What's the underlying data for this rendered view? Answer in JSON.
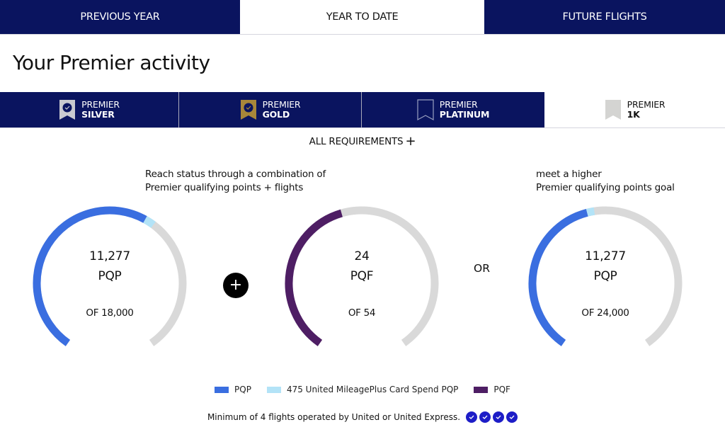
{
  "top_tabs": [
    {
      "label": "PREVIOUS YEAR",
      "active": false
    },
    {
      "label": "YEAR TO DATE",
      "active": true
    },
    {
      "label": "FUTURE FLIGHTS",
      "active": false
    }
  ],
  "page_title": "Your Premier activity",
  "tiers": [
    {
      "line1": "PREMIER",
      "line2": "SILVER",
      "icon": "silver-badge-icon",
      "badge_color": "#c9cad0",
      "selected": false
    },
    {
      "line1": "PREMIER",
      "line2": "GOLD",
      "icon": "gold-badge-icon",
      "badge_color": "#a8873a",
      "selected": false
    },
    {
      "line1": "PREMIER",
      "line2": "PLATINUM",
      "icon": "platinum-badge-outline-icon",
      "badge_color": "#0a145f",
      "selected": false
    },
    {
      "line1": "PREMIER",
      "line2": "1K",
      "icon": "1k-badge-icon",
      "badge_color": "#d4d4d2",
      "selected": true
    }
  ],
  "all_requirements": {
    "label": "ALL REQUIREMENTS",
    "icon": "+"
  },
  "descriptions": {
    "combo_line1": "Reach status through a combination of",
    "combo_line2": "Premier qualifying points + flights",
    "higher_line1": "meet a higher",
    "higher_line2": "Premier qualifying points goal"
  },
  "gauges": [
    {
      "value": "11,277",
      "unit": "PQP",
      "of_label": "OF 18,000",
      "current": 11277,
      "card_spend": 475,
      "goal": 18000,
      "color": "#3a6ee0"
    },
    {
      "value": "24",
      "unit": "PQF",
      "of_label": "OF 54",
      "current": 24,
      "card_spend": 0,
      "goal": 54,
      "color": "#4e1e64"
    },
    {
      "value": "11,277",
      "unit": "PQP",
      "of_label": "OF 24,000",
      "current": 11277,
      "card_spend": 475,
      "goal": 24000,
      "color": "#3a6ee0"
    }
  ],
  "plus_symbol": "+",
  "or_label": "OR",
  "legend": [
    {
      "label": "PQP",
      "color": "#3a6ee0"
    },
    {
      "label": "475 United MileagePlus Card Spend PQP",
      "color": "#b3e3f7"
    },
    {
      "label": "PQF",
      "color": "#4e1e64"
    }
  ],
  "track_color": "#d9d9d9",
  "card_spend_color": "#b3e3f7",
  "min_flights": {
    "text": "Minimum of 4 flights operated by United or United Express.",
    "completed": 4,
    "required": 4
  }
}
